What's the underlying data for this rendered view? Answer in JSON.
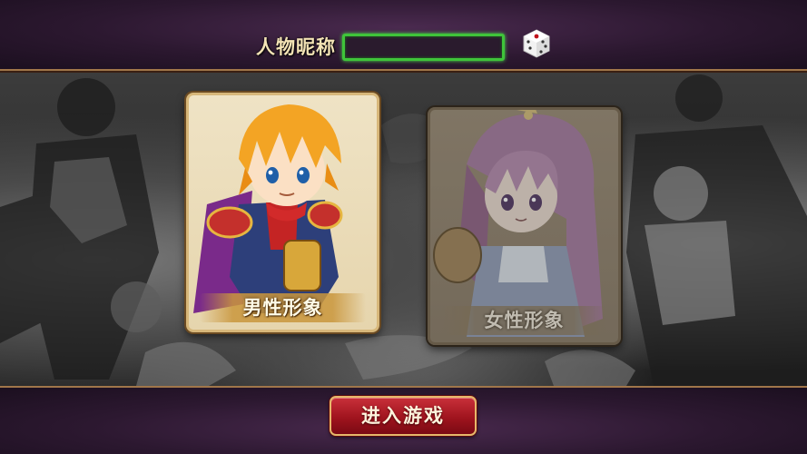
{
  "header": {
    "name_label": "人物昵称",
    "name_input_value": ""
  },
  "cards": {
    "male_label": "男性形象",
    "female_label": "女性形象",
    "selected": "male"
  },
  "footer": {
    "enter_label": "进入游戏"
  },
  "colors": {
    "input_border": "#3fc43a",
    "enter_button": "#a0141e",
    "frame_gold": "#d7b77a"
  },
  "icons": {
    "dice": "dice-icon"
  }
}
